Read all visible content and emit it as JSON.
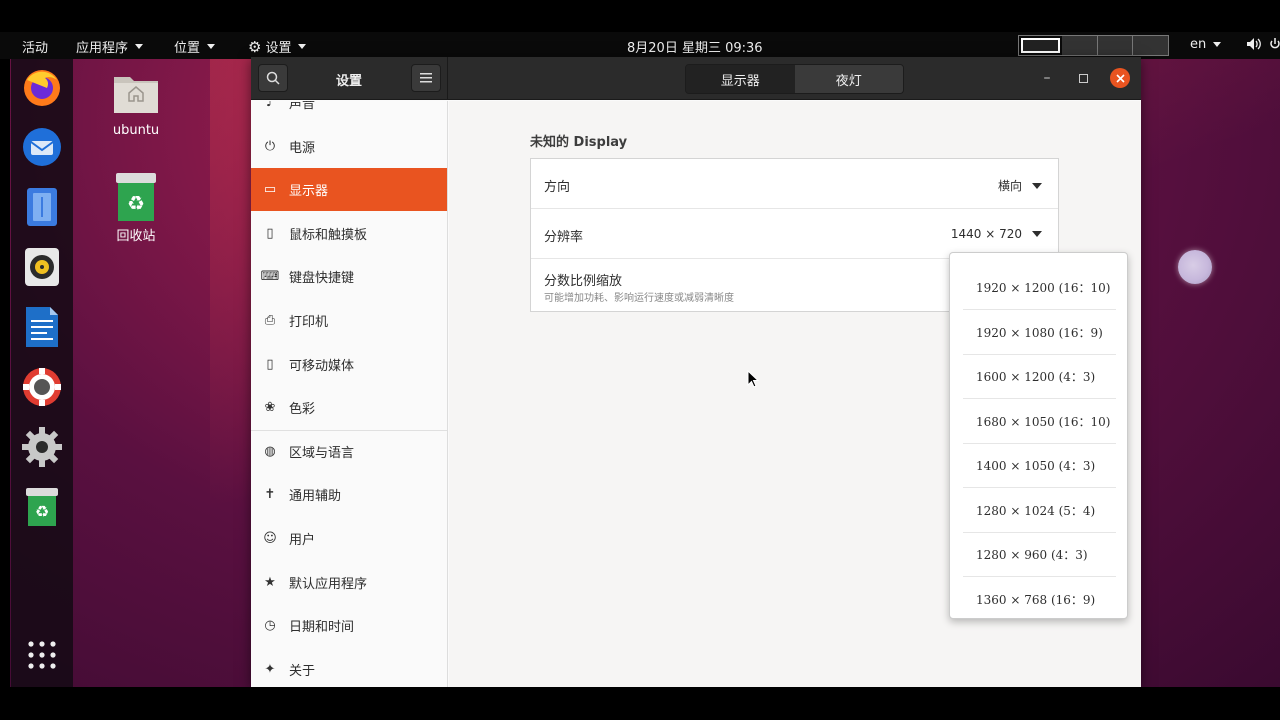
{
  "top_panel": {
    "activities": "活动",
    "applications": "应用程序",
    "places": "位置",
    "app_menu": "设置",
    "clock": "8月20日 星期三  09:36",
    "language": "en"
  },
  "desktop_icons": [
    {
      "label": "ubuntu",
      "icon": "home-folder-icon"
    },
    {
      "label": "回收站",
      "icon": "trash-icon"
    }
  ],
  "dock": {
    "items": [
      "firefox-icon",
      "thunderbird-icon",
      "files-icon",
      "rhythmbox-icon",
      "writer-icon",
      "help-icon",
      "settings-icon",
      "trash-icon"
    ],
    "show_apps": "show-apps-icon"
  },
  "settings_window": {
    "sidebar_title": "设置",
    "view_tabs": [
      {
        "label": "显示器",
        "active": true
      },
      {
        "label": "夜灯",
        "active": false
      }
    ],
    "sidebar_items": [
      {
        "label": "声音",
        "icon": "sound-icon"
      },
      {
        "label": "电源",
        "icon": "power-icon"
      },
      {
        "label": "显示器",
        "icon": "display-icon",
        "active": true
      },
      {
        "label": "鼠标和触摸板",
        "icon": "mouse-icon"
      },
      {
        "label": "键盘快捷键",
        "icon": "keyboard-icon"
      },
      {
        "label": "打印机",
        "icon": "printer-icon"
      },
      {
        "label": "可移动媒体",
        "icon": "removable-media-icon"
      },
      {
        "label": "色彩",
        "icon": "color-icon"
      },
      {
        "label": "区域与语言",
        "icon": "globe-icon"
      },
      {
        "label": "通用辅助",
        "icon": "accessibility-icon"
      },
      {
        "label": "用户",
        "icon": "users-icon"
      },
      {
        "label": "默认应用程序",
        "icon": "star-icon"
      },
      {
        "label": "日期和时间",
        "icon": "clock-icon"
      },
      {
        "label": "关于",
        "icon": "about-icon"
      }
    ],
    "display": {
      "title": "未知的 Display",
      "orientation": {
        "label": "方向",
        "value": "横向"
      },
      "resolution": {
        "label": "分辨率",
        "value": "1440 × 720"
      },
      "fractional_scaling": {
        "label": "分数比例缩放",
        "subtitle": "可能增加功耗、影响运行速度或减弱清晰度"
      }
    },
    "resolution_options": [
      "1920 × 1200 (16：10)",
      "1920 × 1080 (16：9)",
      "1600 × 1200 (4：3)",
      "1680 × 1050 (16：10)",
      "1400 × 1050 (4：3)",
      "1280 × 1024 (5：4)",
      "1280 × 960 (4：3)",
      "1360 × 768 (16：9)"
    ]
  },
  "colors": {
    "accent": "#e95420",
    "headerbar": "#2b2b2b",
    "panel": "#0a0a0a"
  }
}
